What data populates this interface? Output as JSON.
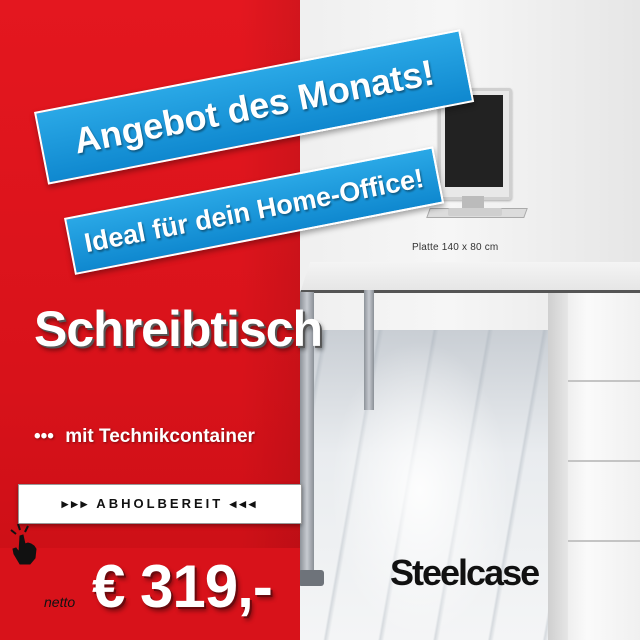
{
  "promo": {
    "headline": "Angebot des Monats!",
    "tagline": "Ideal für dein Home-Office!",
    "product": "Schreibtisch",
    "feature_bullets": "•••",
    "feature": "mit Technikcontainer",
    "pickup": "▸▸▸ ABHOLBEREIT ◂◂◂",
    "price_prefix": "netto",
    "price": "€ 319,-"
  },
  "image": {
    "size_caption": "Platte 140 x 80 cm",
    "brand": "Steelcase"
  },
  "colors": {
    "red": "#d8121a",
    "blue": "#0f88cf",
    "white": "#ffffff"
  },
  "icons": {
    "cursor": "hand-pointer-icon"
  }
}
